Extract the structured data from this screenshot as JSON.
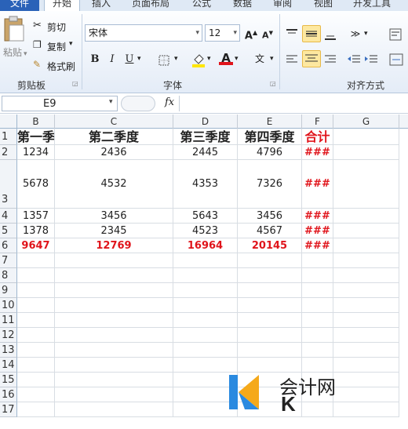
{
  "tabs": [
    "文件",
    "开始",
    "插入",
    "页面布局",
    "公式",
    "数据",
    "审阅",
    "视图",
    "开发工具"
  ],
  "clipboard": {
    "paste": "粘贴",
    "cut": "剪切",
    "copy": "复制",
    "format_painter": "格式刷",
    "group": "剪贴板"
  },
  "font": {
    "name": "宋体",
    "size": "12",
    "group": "字体",
    "bold": "B",
    "italic": "I",
    "underline": "U",
    "color_label": "A"
  },
  "align": {
    "group": "对齐方式"
  },
  "formula_bar": {
    "name_box": "E9",
    "fx": "fx",
    "value": ""
  },
  "columns": [
    "B",
    "C",
    "D",
    "E",
    "F",
    "G"
  ],
  "rows": [
    {
      "num": "1",
      "cells": [
        "第一季度",
        "第二季度",
        "第三季度",
        "第四季度",
        "合计",
        ""
      ]
    },
    {
      "num": "2",
      "cells": [
        "1234",
        "2436",
        "2445",
        "4796",
        "###",
        ""
      ]
    },
    {
      "num": "3",
      "cells": [
        "5678",
        "4532",
        "4353",
        "7326",
        "###",
        ""
      ]
    },
    {
      "num": "4",
      "cells": [
        "1357",
        "3456",
        "5643",
        "3456",
        "###",
        ""
      ]
    },
    {
      "num": "5",
      "cells": [
        "1378",
        "2345",
        "4523",
        "4567",
        "###",
        ""
      ]
    },
    {
      "num": "6",
      "cells": [
        "9647",
        "12769",
        "16964",
        "20145",
        "###",
        ""
      ]
    },
    {
      "num": "7"
    },
    {
      "num": "8"
    },
    {
      "num": "9"
    },
    {
      "num": "10"
    },
    {
      "num": "11"
    },
    {
      "num": "12"
    },
    {
      "num": "13"
    },
    {
      "num": "14"
    },
    {
      "num": "15"
    },
    {
      "num": "16"
    },
    {
      "num": "17"
    }
  ],
  "watermark": "会计网",
  "colors": {
    "accent_red": "#e0141b",
    "file_tab": "#2a62b8",
    "highlight": "#fde8a0"
  }
}
